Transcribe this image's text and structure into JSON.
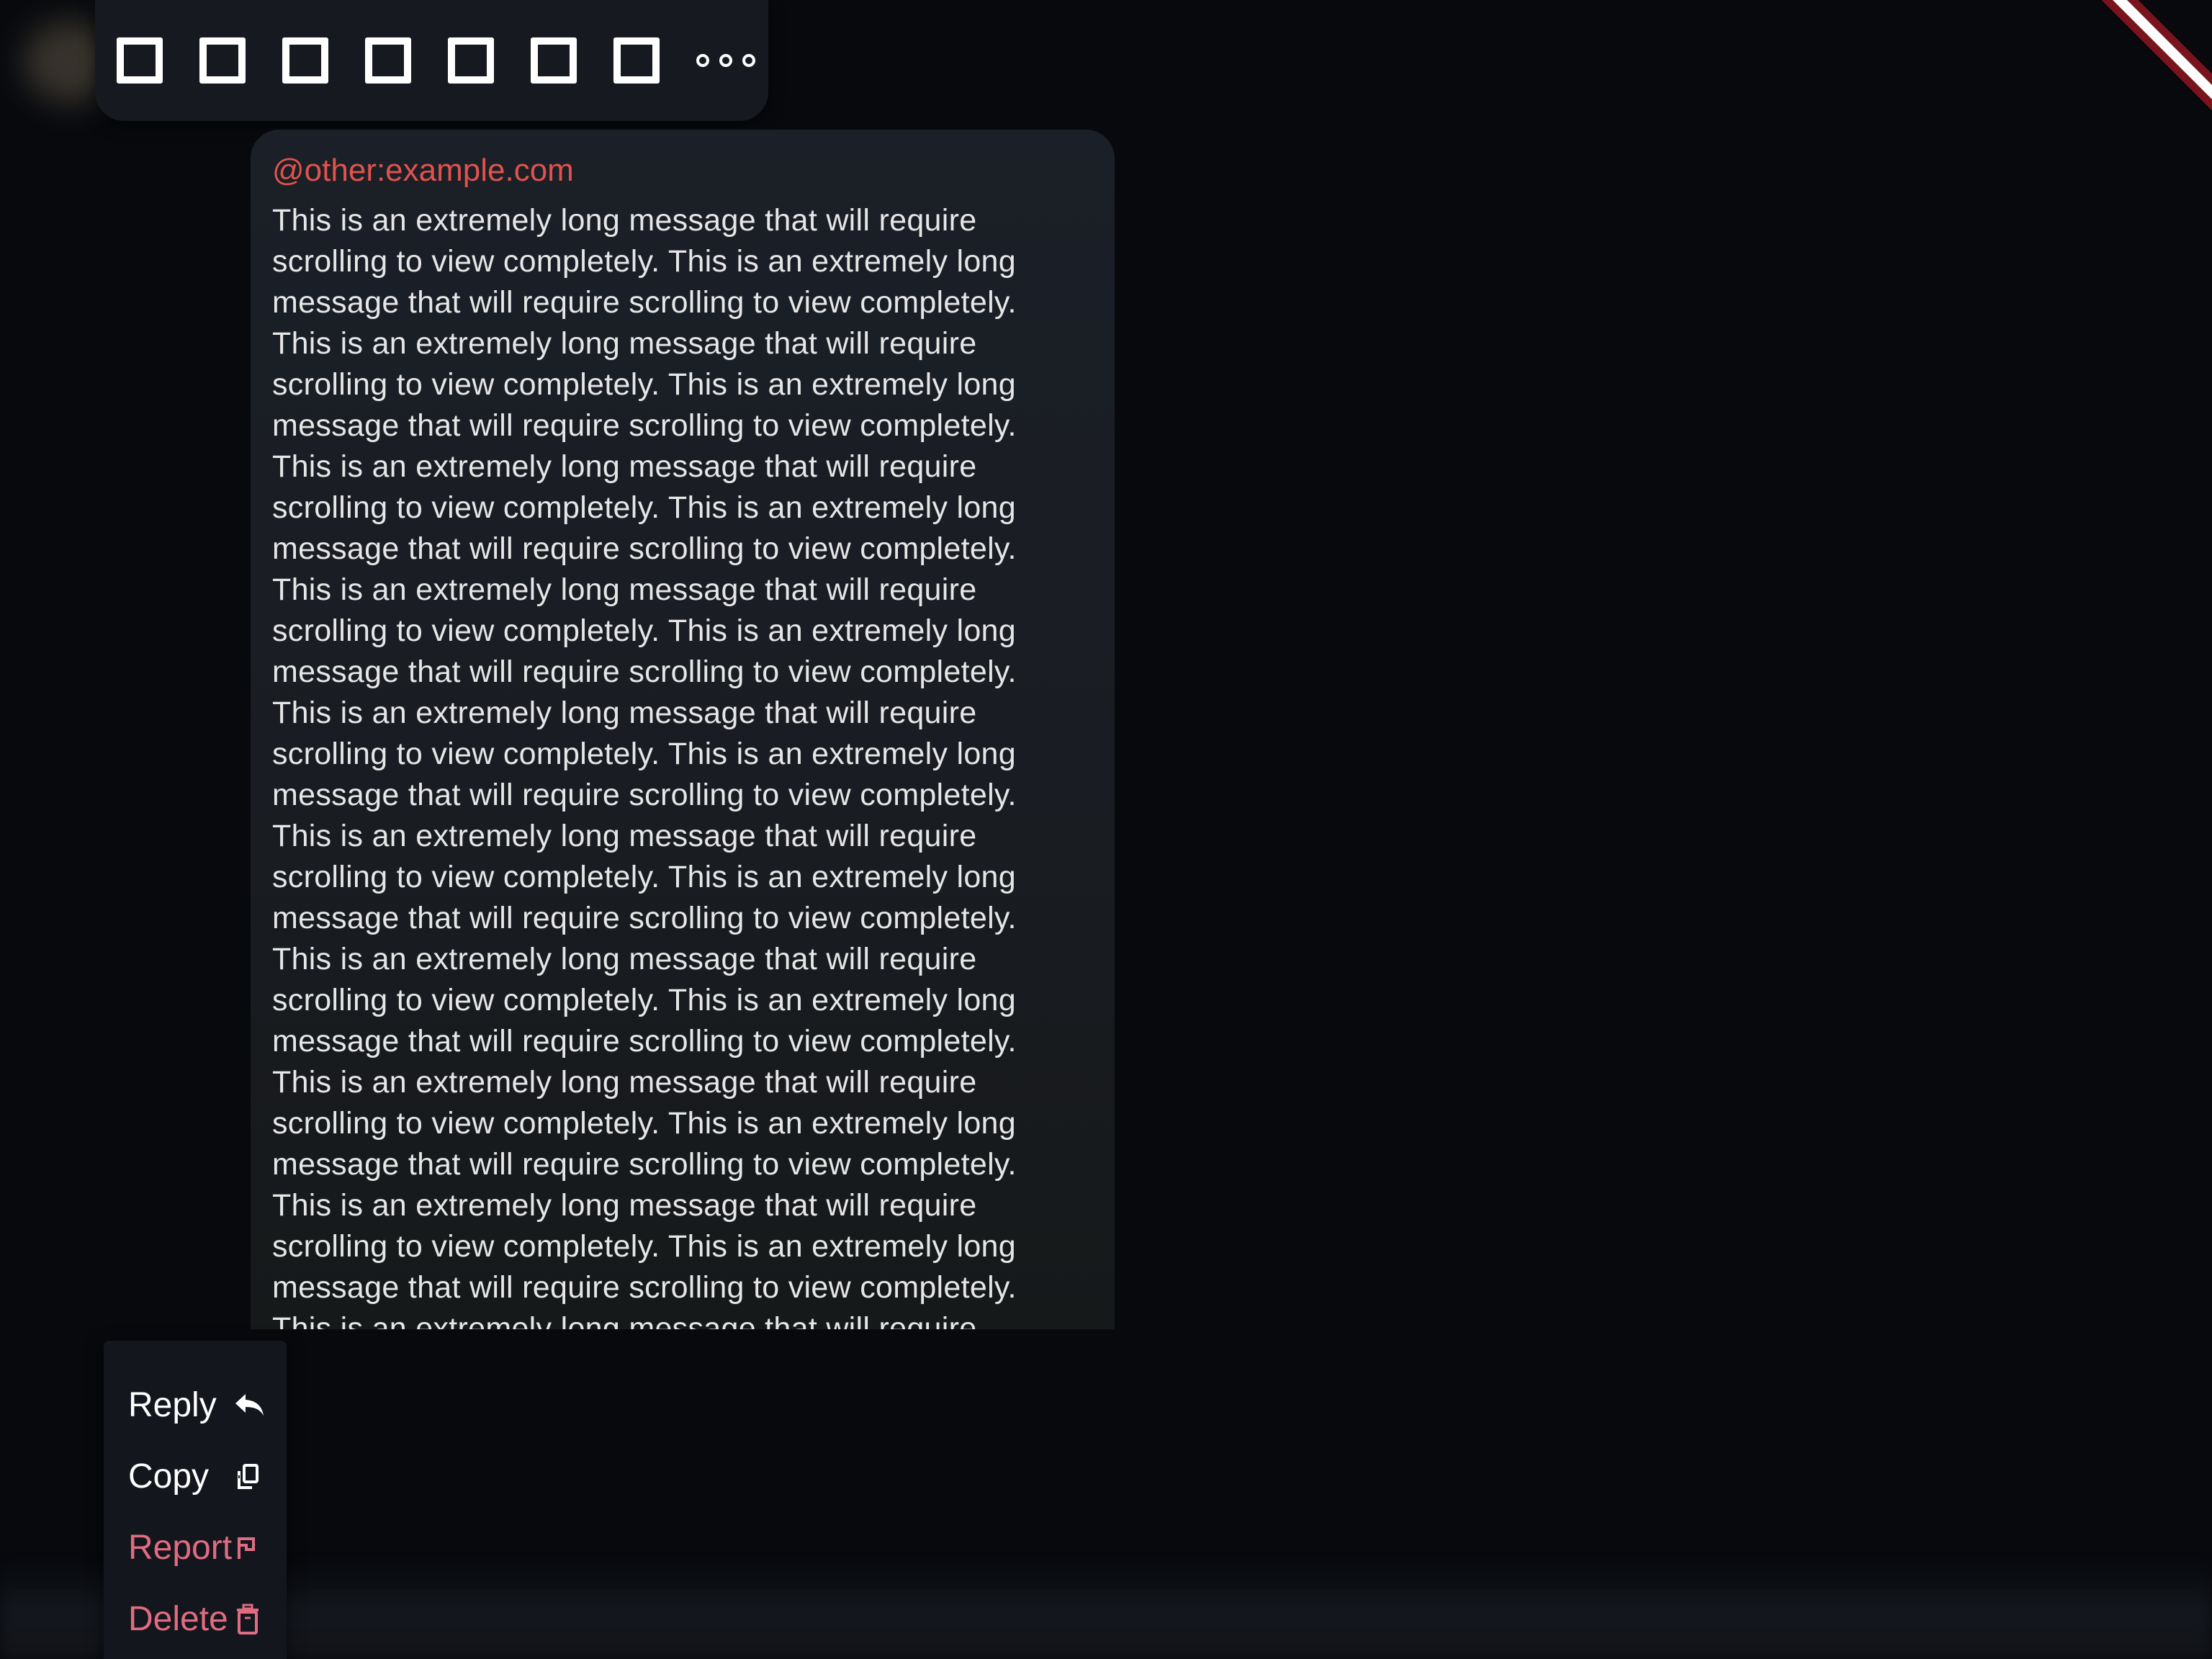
{
  "reactions": {
    "items": [
      {
        "label": "",
        "icon": "missing-glyph-box"
      },
      {
        "label": "",
        "icon": "missing-glyph-box"
      },
      {
        "label": "",
        "icon": "missing-glyph-box"
      },
      {
        "label": "",
        "icon": "missing-glyph-box"
      },
      {
        "label": "",
        "icon": "missing-glyph-box"
      },
      {
        "label": "",
        "icon": "missing-glyph-box"
      },
      {
        "label": "",
        "icon": "missing-glyph-box"
      }
    ],
    "more_icon": "more-horizontal-icon"
  },
  "message": {
    "sender": "@other:example.com",
    "lines": [
      "This is an extremely long message that will require",
      "scrolling to view completely. This is an extremely long",
      "message that will require scrolling to view completely.",
      "This is an extremely long message that will require",
      "scrolling to view completely. This is an extremely long",
      "message that will require scrolling to view completely.",
      "This is an extremely long message that will require",
      "scrolling to view completely. This is an extremely long",
      "message that will require scrolling to view completely.",
      "This is an extremely long message that will require",
      "scrolling to view completely. This is an extremely long",
      "message that will require scrolling to view completely.",
      "This is an extremely long message that will require",
      "scrolling to view completely. This is an extremely long",
      "message that will require scrolling to view completely.",
      "This is an extremely long message that will require",
      "scrolling to view completely. This is an extremely long",
      "message that will require scrolling to view completely.",
      "This is an extremely long message that will require",
      "scrolling to view completely. This is an extremely long",
      "message that will require scrolling to view completely.",
      "This is an extremely long message that will require",
      "scrolling to view completely. This is an extremely long",
      "message that will require scrolling to view completely.",
      "This is an extremely long message that will require",
      "scrolling to view completely. This is an extremely long",
      "message that will require scrolling to view completely.",
      "This is an extremely long message that will require"
    ]
  },
  "menu": {
    "reply_label": "Reply",
    "copy_label": "Copy",
    "report_label": "Report",
    "delete_label": "Delete"
  },
  "colors": {
    "background": "#07090d",
    "sender": "#e0534c",
    "danger": "#e06c82",
    "text": "#e6e6e6"
  }
}
